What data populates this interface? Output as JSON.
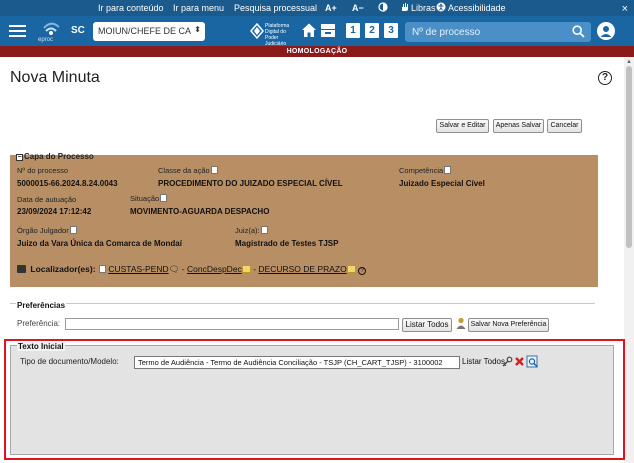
{
  "accessibility_bar": {
    "skip_content": "Ir para conteúdo",
    "skip_menu": "Ir para menu",
    "search_process": "Pesquisa processual",
    "font_increase": "A+",
    "font_decrease": "A−",
    "contrast_icon": "contrast-icon",
    "libras": "Libras",
    "accessibility": "Acessibilidade",
    "close": "×"
  },
  "header": {
    "logo_text": "eproc",
    "state": "SC",
    "profile_select": "MOIUN/CHEFE DE CA",
    "platform_text": "Plataforma Digital do Poder Judiciário",
    "shortcut_numbers": [
      "1",
      "2",
      "3"
    ],
    "search_placeholder": "Nº de processo"
  },
  "environment_banner": "HOMOLOGAÇÃO",
  "page": {
    "title": "Nova Minuta",
    "help": "?"
  },
  "actions": {
    "save_edit": "Salvar e Editar",
    "save_only": "Apenas Salvar",
    "cancel": "Cancelar"
  },
  "capa": {
    "legend": "Capa do Processo",
    "collapse": "−",
    "process_number_label": "Nº do processo",
    "process_number": "5000015-66.2024.8.24.0043",
    "class_label": "Classe da ação",
    "class_value": "PROCEDIMENTO DO JUIZADO ESPECIAL CÍVEL",
    "competence_label": "Competência",
    "competence_value": "Juizado Especial Cível",
    "autuacao_label": "Data de autuação",
    "autuacao_value": "23/09/2024 17:12:42",
    "situacao_label": "Situação",
    "situacao_value": "MOVIMENTO-AGUARDA DESPACHO",
    "orgao_label": "Órgão Julgador",
    "orgao_value": "Juizo da Vara Única da Comarca de Mondaí",
    "juiz_label": "Juiz(a):",
    "juiz_value": "Magistrado de Testes TJSP",
    "localizadores_label": "Localizador(es):",
    "localizadores": [
      "CUSTAS-PEND",
      "ConcDespDec",
      "DECURSO DE PRAZO"
    ],
    "separator": "-"
  },
  "preferences": {
    "legend": "Preferências",
    "label": "Preferência:",
    "input_value": "",
    "list_all": "Listar Todos",
    "save_new": "Salvar Nova Preferência"
  },
  "texto_inicial": {
    "legend": "Texto Inicial",
    "doc_type_label": "Tipo de documento/Modelo:",
    "doc_type_value": "Termo de Audiência - Termo de Audiência Conciliação - TSJP (CH_CART_TJSP) - 3100002",
    "list_all": "Listar Todos"
  },
  "colors": {
    "header_blue": "#1966a3",
    "accessibility_blue": "#1b5a8c",
    "homologacao_red": "#8b1a1a",
    "capa_brown": "#b88f65",
    "highlight_red": "#e0141e"
  }
}
